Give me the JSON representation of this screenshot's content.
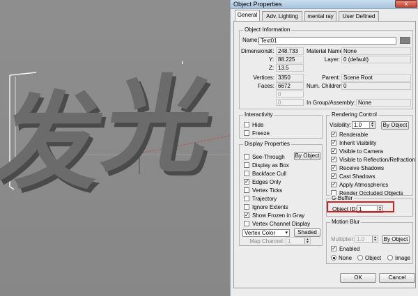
{
  "dialog": {
    "title": "Object Properties",
    "close_glyph": "x",
    "tabs": [
      "General",
      "Adv. Lighting",
      "mental ray",
      "User Defined"
    ]
  },
  "object_info": {
    "title": "Object Information",
    "name_label": "Name:",
    "name_value": "Text01",
    "dimensions_label": "Dimensions:",
    "x_label": "X:",
    "x_value": "248.733",
    "y_label": "Y:",
    "y_value": "88.225",
    "z_label": "Z:",
    "z_value": "13.5",
    "material_label": "Material Name:",
    "material_value": "None",
    "layer_label": "Layer:",
    "layer_value": "0 (default)",
    "vertices_label": "Vertices:",
    "vertices_value": "3350",
    "faces_label": "Faces:",
    "faces_value": "6672",
    "parent_label": "Parent:",
    "parent_value": "Scene Root",
    "children_label": "Num. Children:",
    "children_value": "0",
    "blank1_value": "0",
    "blank2_value": "0",
    "group_label": "In Group/Assembly:",
    "group_value": "None"
  },
  "interactivity": {
    "title": "Interactivity",
    "hide": "Hide",
    "freeze": "Freeze"
  },
  "display_properties": {
    "title": "Display Properties",
    "by_object": "By Object",
    "see_through": "See-Through",
    "display_as_box": "Display as Box",
    "backface_cull": "Backface Cull",
    "edges_only": "Edges Only",
    "vertex_ticks": "Vertex Ticks",
    "trajectory": "Trajectory",
    "ignore_extents": "Ignore Extents",
    "show_frozen_gray": "Show Frozen in Gray",
    "vertex_channel_display": "Vertex Channel Display",
    "vertex_color": "Vertex Color",
    "shaded": "Shaded",
    "map_channel_label": "Map Channel:",
    "map_channel_value": "1"
  },
  "rendering_control": {
    "title": "Rendering Control",
    "visibility_label": "Visibility:",
    "visibility_value": "1.0",
    "by_object": "By Object",
    "renderable": "Renderable",
    "inherit_visibility": "Inherit Visibility",
    "visible_to_camera": "Visible to Camera",
    "visible_to_reflection": "Visible to Reflection/Refraction",
    "receive_shadows": "Receive Shadows",
    "cast_shadows": "Cast Shadows",
    "apply_atmospherics": "Apply Atmospherics",
    "render_occluded": "Render Occluded Objects"
  },
  "gbuffer": {
    "title": "G-Buffer",
    "object_id_label": "Object ID:",
    "object_id_value": "1",
    "highlight_color": "#d02020"
  },
  "motion_blur": {
    "title": "Motion Blur",
    "multiplier_label": "Multiplier:",
    "multiplier_value": "1.0",
    "by_object": "By Object",
    "enabled": "Enabled",
    "none": "None",
    "object": "Object",
    "image": "Image"
  },
  "footer": {
    "ok": "OK",
    "cancel": "Cancel"
  },
  "viewport": {
    "text_glyphs": [
      "发",
      "光"
    ],
    "text_color": "#6b6b6b",
    "bg_color": "#8a8a8a"
  }
}
